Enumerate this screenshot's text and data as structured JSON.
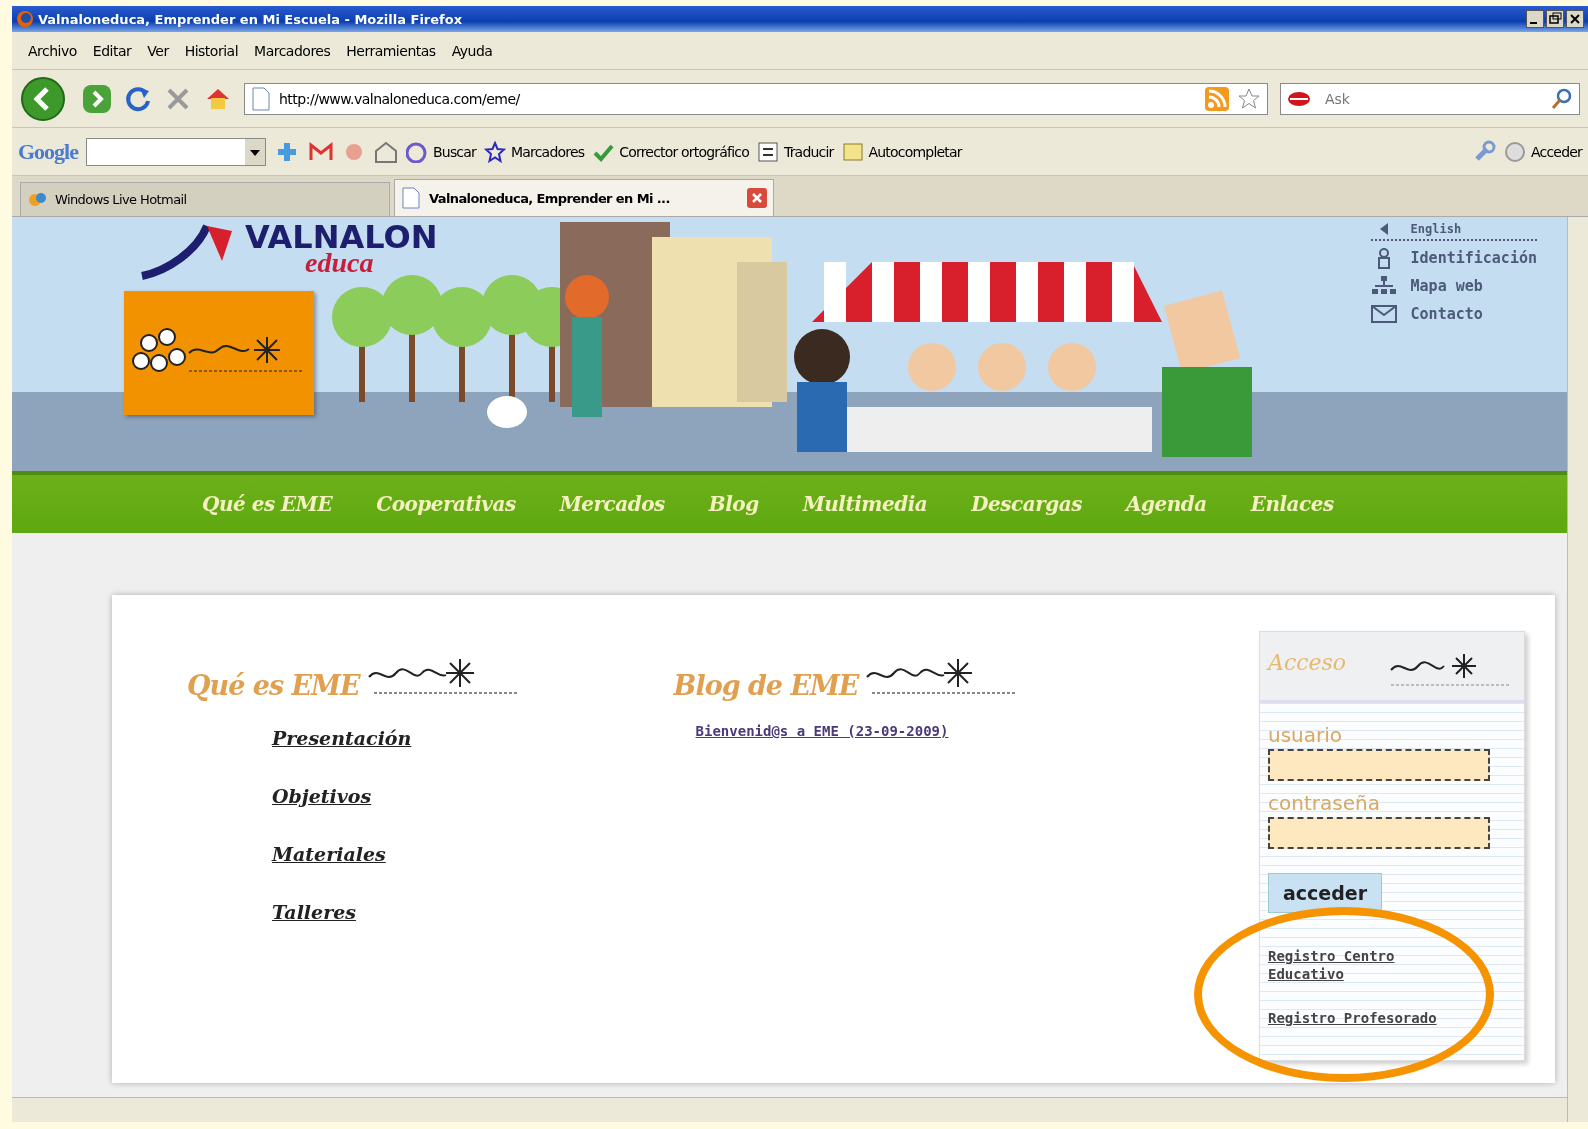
{
  "window": {
    "title": "Valnaloneduca, Emprender en Mi Escuela - Mozilla Firefox"
  },
  "menu": [
    "Archivo",
    "Editar",
    "Ver",
    "Historial",
    "Marcadores",
    "Herramientas",
    "Ayuda"
  ],
  "address_bar": {
    "url": "http://www.valnaloneduca.com/eme/"
  },
  "search_bar": {
    "placeholder": "Ask"
  },
  "google_toolbar": {
    "logo": "Google",
    "items": [
      "Buscar",
      "Marcadores",
      "Corrector ortográfico",
      "Traducir",
      "Autocompletar",
      "Acceder"
    ]
  },
  "tabs": [
    {
      "label": "Windows Live Hotmail",
      "selected": false
    },
    {
      "label": "Valnaloneduca, Emprender en Mi ...",
      "selected": true
    }
  ],
  "site": {
    "logo": {
      "name": "VALNALON",
      "sub": "educa"
    },
    "top_links": [
      "English",
      "Identificación",
      "Mapa web",
      "Contacto"
    ],
    "nav": [
      "Qué es EME",
      "Cooperativas",
      "Mercados",
      "Blog",
      "Multimedia",
      "Descargas",
      "Agenda",
      "Enlaces"
    ],
    "que_es": {
      "title": "Qué es EME",
      "links": [
        "Presentación",
        "Objetivos",
        "Materiales",
        "Talleres"
      ]
    },
    "blog": {
      "title": "Blog de EME",
      "posts": [
        "Bienvenid@s a EME (23-09-2009)"
      ]
    },
    "login": {
      "title": "Acceso",
      "fields": [
        {
          "label": "usuario"
        },
        {
          "label": "contraseña"
        }
      ],
      "button": "acceder",
      "links": [
        "Registro Centro Educativo",
        "Registro Profesorado"
      ]
    }
  }
}
